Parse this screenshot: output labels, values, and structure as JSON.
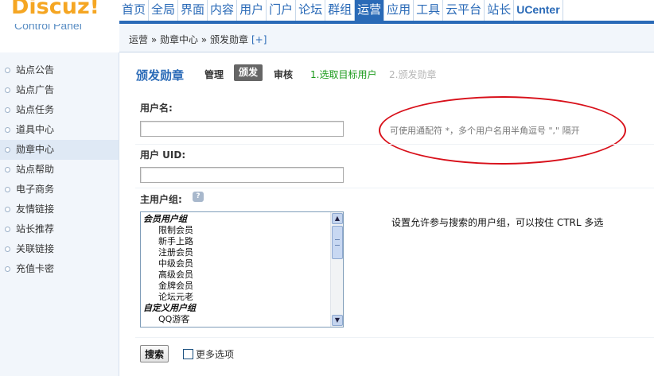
{
  "header": {
    "logo_text": "Discuz!",
    "logo_subtext": "Control Panel",
    "nav": [
      {
        "label": "首页"
      },
      {
        "label": "全局"
      },
      {
        "label": "界面"
      },
      {
        "label": "内容"
      },
      {
        "label": "用户"
      },
      {
        "label": "门户"
      },
      {
        "label": "论坛"
      },
      {
        "label": "群组"
      },
      {
        "label": "运营"
      },
      {
        "label": "应用"
      },
      {
        "label": "工具"
      },
      {
        "label": "云平台"
      },
      {
        "label": "站长"
      },
      {
        "label": "UCenter"
      }
    ],
    "active_nav": "运营"
  },
  "breadcrumb": {
    "text": "运营 » 勋章中心 » 颁发勋章",
    "plus": "[+]"
  },
  "sidebar": {
    "items": [
      {
        "label": "站点公告"
      },
      {
        "label": "站点广告"
      },
      {
        "label": "站点任务"
      },
      {
        "label": "道具中心"
      },
      {
        "label": "勋章中心"
      },
      {
        "label": "站点帮助"
      },
      {
        "label": "电子商务"
      },
      {
        "label": "友情链接"
      },
      {
        "label": "站长推荐"
      },
      {
        "label": "关联链接"
      },
      {
        "label": "充值卡密"
      }
    ],
    "active_item": "勋章中心"
  },
  "main": {
    "title": "颁发勋章",
    "tabs": {
      "manage": "管理",
      "award": "颁发",
      "review": "审核"
    },
    "steps": {
      "step1": "1.选取目标用户",
      "step2": "2.颁发勋章"
    },
    "username": {
      "label": "用户名:",
      "value": "",
      "hint": "可使用通配符 *，多个用户名用半角逗号 \",\" 隔开"
    },
    "uid": {
      "label": "用户 UID:",
      "value": ""
    },
    "group": {
      "label": "主用户组:",
      "help_icon": "help-icon",
      "hint": "设置允许参与搜索的用户组，可以按住 CTRL 多选",
      "options": [
        {
          "label": "会员用户组",
          "type": "group"
        },
        {
          "label": "限制会员",
          "type": "item"
        },
        {
          "label": "新手上路",
          "type": "item"
        },
        {
          "label": "注册会员",
          "type": "item"
        },
        {
          "label": "中级会员",
          "type": "item"
        },
        {
          "label": "高级会员",
          "type": "item"
        },
        {
          "label": "金牌会员",
          "type": "item"
        },
        {
          "label": "论坛元老",
          "type": "item"
        },
        {
          "label": "自定义用户组",
          "type": "group"
        },
        {
          "label": "QQ游客",
          "type": "item"
        }
      ]
    },
    "search_button": "搜索",
    "more_options": "更多选项",
    "colors": {
      "accent": "#2a6ab7",
      "step_active": "#1a9a1a",
      "step_inactive": "#b5b5b5",
      "annotation": "#d8101a",
      "logo": "#f5a623"
    }
  }
}
